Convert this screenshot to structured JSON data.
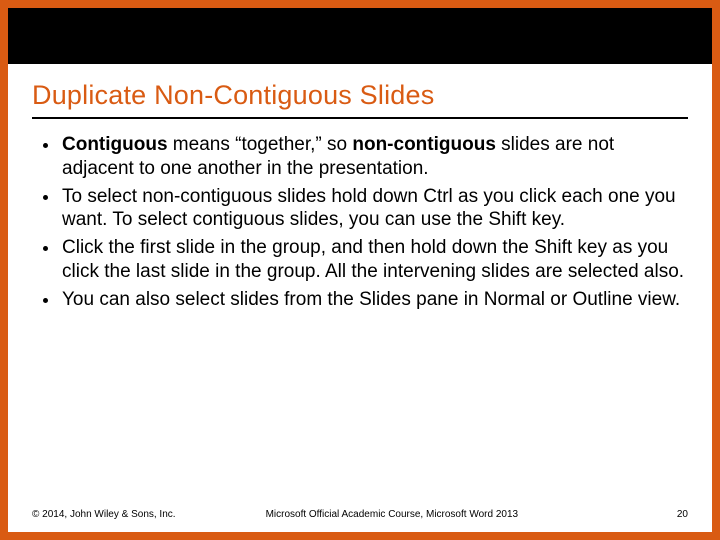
{
  "slide": {
    "title": "Duplicate Non-Contiguous Slides",
    "bullets": [
      {
        "prefix_bold": "Contiguous",
        "mid1": " means “together,” so ",
        "mid_bold": "non-contiguous",
        "suffix": " slides are not adjacent to one another in the presentation."
      },
      {
        "text": "To select non-contiguous slides hold down Ctrl as you click each one you want. To select contiguous slides, you can use the Shift key."
      },
      {
        "text": "Click the first slide in the group, and then hold down the Shift key as you click the last slide in the group. All the intervening slides are selected also."
      },
      {
        "text": "You can also select slides from the Slides pane in Normal or Outline view."
      }
    ]
  },
  "footer": {
    "copyright": "© 2014, John Wiley & Sons, Inc.",
    "course": "Microsoft Official Academic Course, Microsoft Word 2013",
    "page": "20"
  }
}
